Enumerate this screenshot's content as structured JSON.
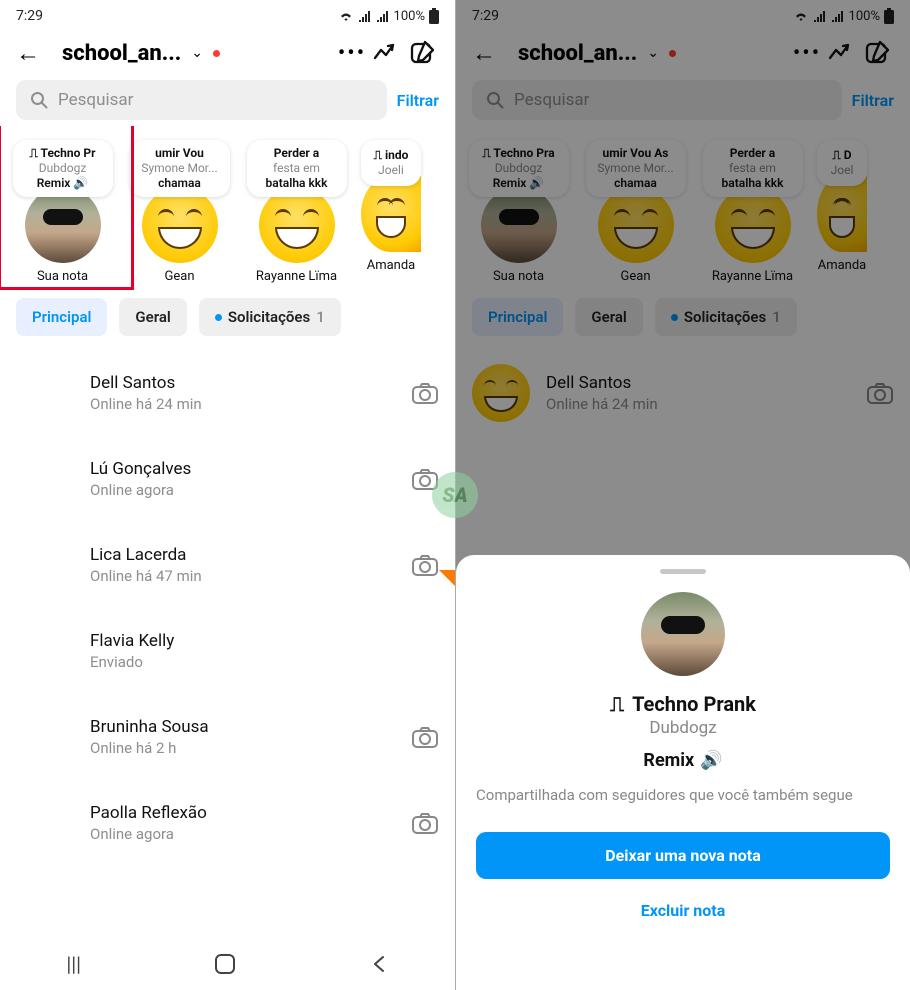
{
  "status": {
    "time": "7:29",
    "battery": "100%"
  },
  "header": {
    "back_glyph": "←",
    "username": "school_an...",
    "chevron": "⌄",
    "more": "•••"
  },
  "search": {
    "placeholder": "Pesquisar",
    "filter": "Filtrar"
  },
  "notes_left": [
    {
      "l1": "⎍ Techno Pr",
      "l2": "Dubdogz",
      "l3": "Remix 🔊",
      "avatar_type": "photo",
      "label": "Sua nota"
    },
    {
      "l1": "umir  Vou",
      "l2": "Symone Mor...",
      "l3": "chamaa",
      "avatar_type": "emoji",
      "label": "Gean"
    },
    {
      "l1": "Perder a",
      "l2": "festa em",
      "l3": "batalha kkk",
      "avatar_type": "emoji",
      "label": "Rayanne Lïma"
    },
    {
      "l1": "⎍ indo",
      "l2": "Joeli",
      "l3": "",
      "avatar_type": "emoji",
      "label": "Amanda"
    }
  ],
  "notes_right": [
    {
      "l1": "⎍ Techno Pra",
      "l2": "Dubdogz",
      "l3": "Remix 🔊",
      "avatar_type": "photo",
      "label": "Sua nota"
    },
    {
      "l1": "umir  Vou As",
      "l2": "Symone Mor...",
      "l3": "chamaa",
      "avatar_type": "emoji",
      "label": "Gean"
    },
    {
      "l1": "Perder a",
      "l2": "festa em",
      "l3": "batalha kkk",
      "avatar_type": "emoji",
      "label": "Rayanne Lïma"
    },
    {
      "l1": "⎍ D",
      "l2": "Joel",
      "l3": "",
      "avatar_type": "emoji",
      "label": "Amanda"
    }
  ],
  "tabs": {
    "principal": "Principal",
    "geral": "Geral",
    "solicitacoes": "Solicitações",
    "solicitacoes_count": "1"
  },
  "chats": [
    {
      "name": "Dell Santos",
      "status": "Online há 24 min",
      "camera": true,
      "avatar": "smiley"
    },
    {
      "name": "Lú Gonçalves",
      "status": "Online agora",
      "camera": true,
      "avatar": "blank"
    },
    {
      "name": "Lica Lacerda",
      "status": "Online há 47 min",
      "camera": true,
      "avatar": "blank"
    },
    {
      "name": "Flavia Kelly",
      "status": "Enviado",
      "camera": false,
      "avatar": "blank"
    },
    {
      "name": "Bruninha Sousa",
      "status": "Online há 2 h",
      "camera": true,
      "avatar": "blank"
    },
    {
      "name": "Paolla Reflexão",
      "status": "Online agora",
      "camera": true,
      "avatar": "blank"
    }
  ],
  "sheet": {
    "title_prefix": "⎍",
    "title": "Techno Prank",
    "artist": "Dubdogz",
    "remix": "Remix",
    "speaker": "🔊",
    "desc": "Compartilhada com seguidores que você também segue",
    "primary": "Deixar uma nova nota",
    "secondary": "Excluir nota"
  },
  "watermark": "SA"
}
